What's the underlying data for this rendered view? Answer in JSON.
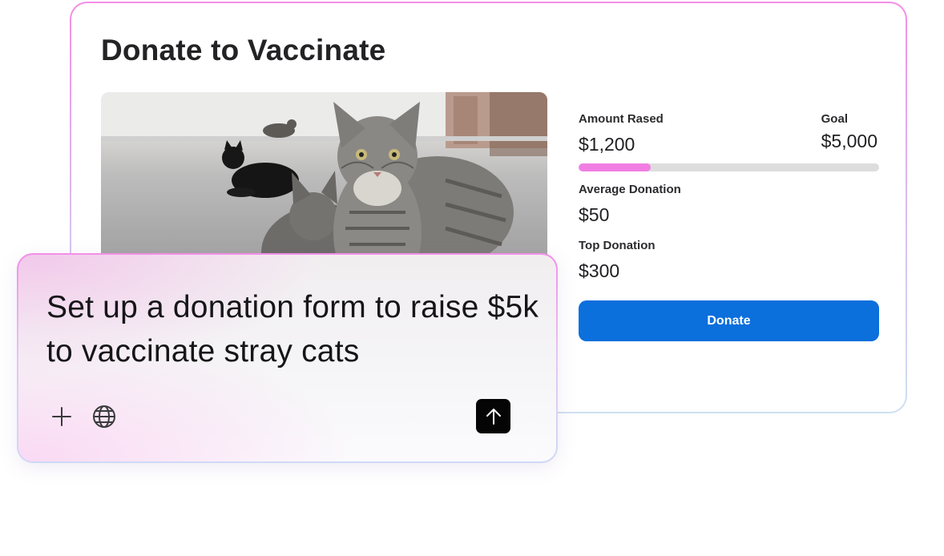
{
  "card": {
    "title": "Donate to Vaccinate",
    "image_alt": "Stray cats sitting on a street"
  },
  "stats": {
    "amount_raised_label": "Amount Rased",
    "amount_raised_value": "$1,200",
    "goal_label": "Goal",
    "goal_value": "$5,000",
    "progress_fraction": 0.24,
    "average_label": "Average Donation",
    "average_value": "$50",
    "top_label": "Top Donation",
    "top_value": "$300"
  },
  "actions": {
    "donate_label": "Donate"
  },
  "prompt": {
    "text": "Set up a donation form to raise $5k to vaccinate stray cats",
    "icons": [
      "plus-icon",
      "globe-icon",
      "arrow-up-icon"
    ]
  },
  "colors": {
    "accent_blue": "#0b6fdc",
    "progress_pink": "#f07ee2",
    "border_pink": "#f48ee8"
  }
}
